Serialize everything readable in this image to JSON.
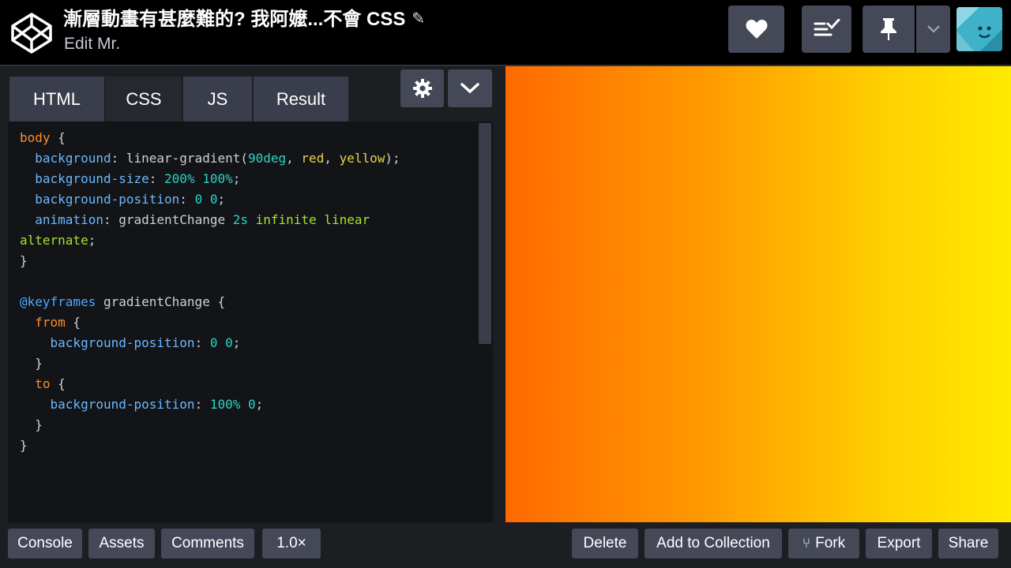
{
  "header": {
    "title": "漸層動畫有甚麼難的? 我阿嬤...不會 CSS",
    "subtitle": "Edit Mr.",
    "icons": [
      "codepen-logo-icon",
      "pencil-icon",
      "heart-icon",
      "list-check-icon",
      "pin-icon",
      "chevron-down-icon",
      "avatar"
    ]
  },
  "editor": {
    "tabs": [
      "HTML",
      "CSS",
      "JS",
      "Result"
    ],
    "active_tab": "CSS",
    "lines": [
      [
        {
          "t": "body",
          "c": "t-sel"
        },
        {
          "t": " {",
          "c": "t-plain"
        }
      ],
      [
        {
          "t": "  background",
          "c": "t-prop"
        },
        {
          "t": ": linear-gradient(",
          "c": "t-plain"
        },
        {
          "t": "90deg",
          "c": "t-num"
        },
        {
          "t": ", ",
          "c": "t-plain"
        },
        {
          "t": "red",
          "c": "t-kw"
        },
        {
          "t": ", ",
          "c": "t-plain"
        },
        {
          "t": "yellow",
          "c": "t-kw"
        },
        {
          "t": ");",
          "c": "t-plain"
        }
      ],
      [
        {
          "t": "  background-size",
          "c": "t-prop"
        },
        {
          "t": ": ",
          "c": "t-plain"
        },
        {
          "t": "200% 100%",
          "c": "t-num"
        },
        {
          "t": ";",
          "c": "t-plain"
        }
      ],
      [
        {
          "t": "  background-position",
          "c": "t-prop"
        },
        {
          "t": ": ",
          "c": "t-plain"
        },
        {
          "t": "0 0",
          "c": "t-num"
        },
        {
          "t": ";",
          "c": "t-plain"
        }
      ],
      [
        {
          "t": "  animation",
          "c": "t-prop"
        },
        {
          "t": ": gradientChange ",
          "c": "t-plain"
        },
        {
          "t": "2s",
          "c": "t-num"
        },
        {
          "t": " infinite linear",
          "c": "t-lime"
        }
      ],
      [
        {
          "t": "alternate",
          "c": "t-lime"
        },
        {
          "t": ";",
          "c": "t-plain"
        }
      ],
      [
        {
          "t": "}",
          "c": "t-plain"
        }
      ],
      [
        {
          "t": "",
          "c": "t-plain"
        }
      ],
      [
        {
          "t": "@keyframes",
          "c": "t-at"
        },
        {
          "t": " gradientChange {",
          "c": "t-plain"
        }
      ],
      [
        {
          "t": "  from",
          "c": "t-sel"
        },
        {
          "t": " {",
          "c": "t-plain"
        }
      ],
      [
        {
          "t": "    background-position",
          "c": "t-prop"
        },
        {
          "t": ": ",
          "c": "t-plain"
        },
        {
          "t": "0 0",
          "c": "t-num"
        },
        {
          "t": ";",
          "c": "t-plain"
        }
      ],
      [
        {
          "t": "  }",
          "c": "t-plain"
        }
      ],
      [
        {
          "t": "  to",
          "c": "t-sel"
        },
        {
          "t": " {",
          "c": "t-plain"
        }
      ],
      [
        {
          "t": "    background-position",
          "c": "t-prop"
        },
        {
          "t": ": ",
          "c": "t-plain"
        },
        {
          "t": "100% 0",
          "c": "t-num"
        },
        {
          "t": ";",
          "c": "t-plain"
        }
      ],
      [
        {
          "t": "  }",
          "c": "t-plain"
        }
      ],
      [
        {
          "t": "}",
          "c": "t-plain"
        }
      ]
    ]
  },
  "preview": {
    "gradient_colors": [
      "#ff6a00",
      "#ffea00"
    ]
  },
  "footer": {
    "left_buttons": [
      "Console",
      "Assets",
      "Comments",
      "1.0×"
    ],
    "right_buttons": [
      "Delete",
      "Add to Collection",
      "Fork",
      "Export",
      "Share"
    ]
  },
  "colors": {
    "header_bg": "#000000",
    "button_bg": "#444857",
    "editor_bg": "#131417",
    "tab_bg": "#3a3d4b"
  }
}
